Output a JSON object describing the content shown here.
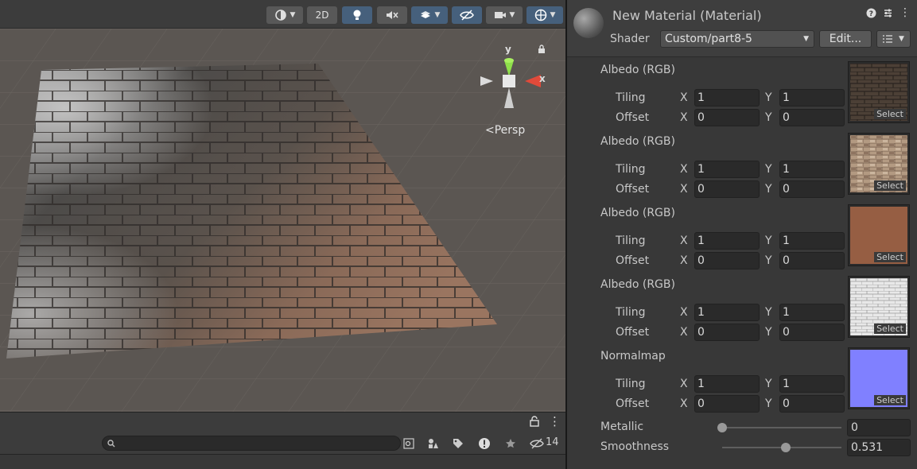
{
  "scene": {
    "toolbar": {
      "mode_2d": "2D"
    },
    "camera_label": "Persp",
    "axis_labels": {
      "x": "x",
      "y": "y"
    }
  },
  "project_bar": {
    "search_placeholder": "",
    "hidden_count": "14"
  },
  "inspector": {
    "title": "New Material (Material)",
    "shader_label": "Shader",
    "shader_value": "Custom/part8-5",
    "edit_label": "Edit...",
    "textures": [
      {
        "name": "Albedo (RGB)",
        "tiling_label": "Tiling",
        "offset_label": "Offset",
        "tiling_x": "1",
        "tiling_y": "1",
        "offset_x": "0",
        "offset_y": "0",
        "select_label": "Select",
        "swatch": "brick-dark"
      },
      {
        "name": "Albedo (RGB)",
        "tiling_label": "Tiling",
        "offset_label": "Offset",
        "tiling_x": "1",
        "tiling_y": "1",
        "offset_x": "0",
        "offset_y": "0",
        "select_label": "Select",
        "swatch": "stone-beige"
      },
      {
        "name": "Albedo (RGB)",
        "tiling_label": "Tiling",
        "offset_label": "Offset",
        "tiling_x": "1",
        "tiling_y": "1",
        "offset_x": "0",
        "offset_y": "0",
        "select_label": "Select",
        "swatch": "brick-red"
      },
      {
        "name": "Albedo (RGB)",
        "tiling_label": "Tiling",
        "offset_label": "Offset",
        "tiling_x": "1",
        "tiling_y": "1",
        "offset_x": "0",
        "offset_y": "0",
        "select_label": "Select",
        "swatch": "brick-white"
      },
      {
        "name": "Normalmap",
        "tiling_label": "Tiling",
        "offset_label": "Offset",
        "tiling_x": "1",
        "tiling_y": "1",
        "offset_x": "0",
        "offset_y": "0",
        "select_label": "Select",
        "swatch": "normal-blue"
      }
    ],
    "axis_x": "X",
    "axis_y": "Y",
    "metallic": {
      "label": "Metallic",
      "value": "0",
      "fraction": 0.0
    },
    "smoothness": {
      "label": "Smoothness",
      "value": "0.531",
      "fraction": 0.531
    }
  },
  "colors": {
    "accent_button": "#46607c",
    "panel_bg": "#383838",
    "field_bg": "#2a2a2a",
    "normal_map": "#8080ff"
  },
  "icons": [
    "shading-mode-icon",
    "lighting-icon",
    "audio-mute-icon",
    "effects-icon",
    "visibility-icon",
    "camera-icon",
    "gizmos-icon",
    "lock-icon",
    "more-icon",
    "search-icon",
    "help-icon",
    "preset-icon"
  ]
}
